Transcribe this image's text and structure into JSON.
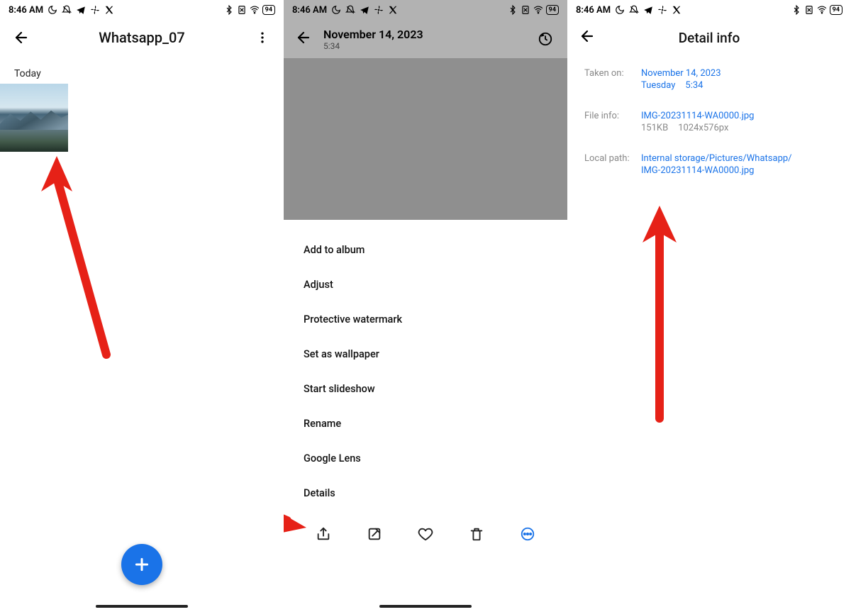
{
  "status": {
    "time": "8:46 AM",
    "battery": "94"
  },
  "panel1": {
    "title": "Whatsapp_07",
    "section": "Today"
  },
  "panel2": {
    "date": "November 14, 2023",
    "time": "5:34",
    "menu": [
      "Add to album",
      "Adjust",
      "Protective watermark",
      "Set as wallpaper",
      "Start slideshow",
      "Rename",
      "Google Lens",
      "Details"
    ]
  },
  "panel3": {
    "title": "Detail info",
    "taken_label": "Taken on:",
    "taken_date": "November 14, 2023",
    "taken_day": "Tuesday",
    "taken_time": "5:34",
    "file_label": "File info:",
    "file_name": "IMG-20231114-WA0000.jpg",
    "file_size": "151KB",
    "file_dims": "1024x576px",
    "path_label": "Local path:",
    "path1": "Internal storage/Pictures/Whatsapp/",
    "path2": "IMG-20231114-WA0000.jpg"
  }
}
